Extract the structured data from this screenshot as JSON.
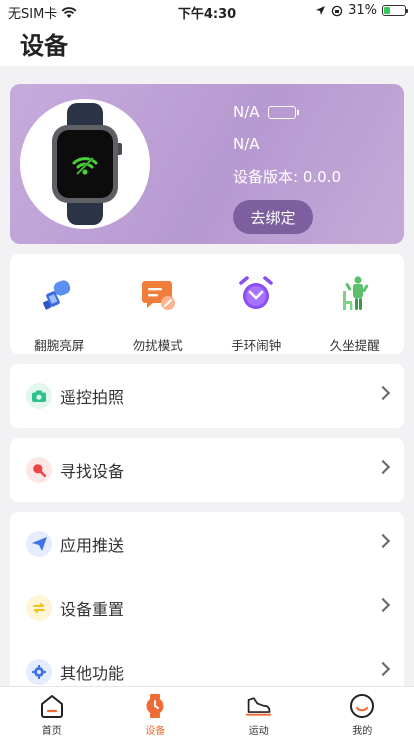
{
  "status_bar": {
    "carrier": "无SIM卡",
    "time": "下午4:30",
    "battery_percent": "31%",
    "battery_level": 0.31
  },
  "header": {
    "title": "设备"
  },
  "device": {
    "name": "N/A",
    "address": "N/A",
    "version": "设备版本: 0.0.0",
    "unbind_label": "去绑定"
  },
  "quick_actions": [
    {
      "label": "翻腕亮屏",
      "icon": "raise-wrist-icon"
    },
    {
      "label": "勿扰模式",
      "icon": "do-not-disturb-icon"
    },
    {
      "label": "手环闹钟",
      "icon": "alarm-clock-icon"
    },
    {
      "label": "久坐提醒",
      "icon": "sedentary-reminder-icon"
    }
  ],
  "menu": {
    "remote_photo": "遥控拍照",
    "find_device": "寻找设备",
    "app_push": "应用推送",
    "device_reset": "设备重置",
    "other_functions": "其他功能"
  },
  "tabbar": {
    "home": "首页",
    "device": "设备",
    "sport": "运动",
    "mine": "我的"
  },
  "colors": {
    "accent": "#f06a35",
    "card_purple": "#b799d1",
    "button_purple": "#7d5fa0"
  }
}
